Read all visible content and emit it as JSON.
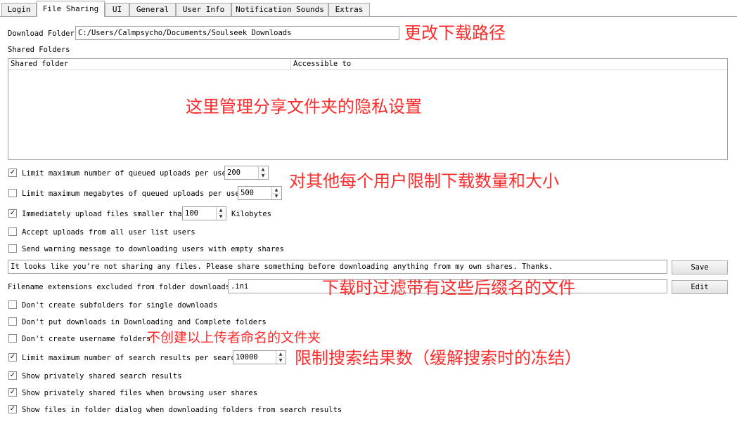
{
  "tabs": [
    {
      "label": "Login",
      "active": false
    },
    {
      "label": "File Sharing",
      "active": true
    },
    {
      "label": "UI",
      "active": false
    },
    {
      "label": "General",
      "active": false
    },
    {
      "label": "User Info",
      "active": false
    },
    {
      "label": "Notification Sounds",
      "active": false
    },
    {
      "label": "Extras",
      "active": false
    }
  ],
  "download_folder": {
    "label": "Download Folder",
    "value": "C:/Users/Calmpsycho/Documents/Soulseek Downloads"
  },
  "shared_folders": {
    "label": "Shared Folders",
    "columns": [
      "Shared folder",
      "Accessible to"
    ],
    "rows": []
  },
  "options": {
    "limit_queued_uploads": {
      "label": "Limit maximum number of queued uploads per user",
      "checked": true,
      "value": "200"
    },
    "limit_megabytes": {
      "label": "Limit maximum megabytes of queued uploads per user",
      "checked": false,
      "value": "500"
    },
    "immediately_upload": {
      "label": "Immediately upload files smaller than",
      "checked": true,
      "value": "100",
      "unit": "Kilobytes"
    },
    "accept_uploads": {
      "label": "Accept uploads from all user list users",
      "checked": false
    },
    "send_warning": {
      "label": "Send warning message to downloading users with empty shares",
      "checked": false
    }
  },
  "warning_message": {
    "value": "It looks like you're not sharing any files. Please share something before downloading anything from my own shares. Thanks.",
    "save_label": "Save"
  },
  "excluded_extensions": {
    "label": "Filename extensions excluded from folder downloads:",
    "value": ".ini",
    "edit_label": "Edit"
  },
  "options2": {
    "no_subfolders": {
      "label": "Don't create subfolders for single downloads",
      "checked": false
    },
    "no_downloading_complete": {
      "label": "Don't put downloads in Downloading and Complete folders",
      "checked": false
    },
    "no_username_folders": {
      "label": "Don't create username folders",
      "checked": false
    },
    "limit_search_results": {
      "label": "Limit maximum number of search results per search",
      "checked": true,
      "value": "10000"
    },
    "show_private_search": {
      "label": "Show privately shared search results",
      "checked": true
    },
    "show_private_browse": {
      "label": "Show privately shared files when browsing user shares",
      "checked": true
    },
    "show_files_dialog": {
      "label": "Show files in folder dialog when downloading folders from search results",
      "checked": true
    }
  },
  "annotations": {
    "change_path": "更改下载路径",
    "privacy": "这里管理分享文件夹的隐私设置",
    "per_user_limit": "对其他每个用户限制下载数量和大小",
    "filter_ext": "下载时过滤带有这些后缀名的文件",
    "no_folders": "不创建以上传者命名的文件夹",
    "limit_results": "限制搜索结果数（缓解搜索时的冻结）"
  },
  "colors": {
    "annotation": "#ff2a2a"
  }
}
